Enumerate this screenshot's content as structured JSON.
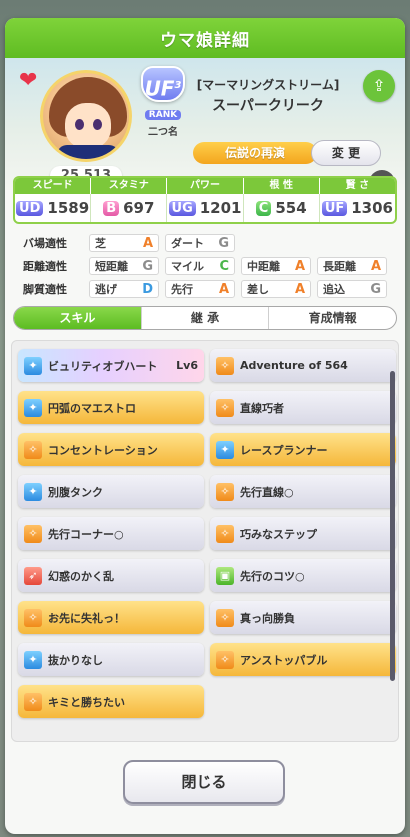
{
  "header": {
    "title": "ウマ娘詳細"
  },
  "profile": {
    "fans": "25,513",
    "rank": "UF",
    "rank_sub": "3",
    "rank_label": "RANK",
    "nickname": "二つ名",
    "epithet": "[マーマリングストリーム]",
    "name": "スーパークリーク",
    "title_tag": "伝説の再演",
    "change_label": "変 更",
    "sub_value": "ー"
  },
  "stats": [
    {
      "label": "スピード",
      "grade": "UD",
      "value": "1589"
    },
    {
      "label": "スタミナ",
      "grade": "B",
      "value": "697"
    },
    {
      "label": "パワー",
      "grade": "UG",
      "value": "1201"
    },
    {
      "label": "根 性",
      "grade": "C",
      "value": "554"
    },
    {
      "label": "賢 さ",
      "grade": "UF",
      "value": "1306"
    }
  ],
  "aptitude": {
    "track_label": "バ場適性",
    "track": [
      {
        "name": "芝",
        "level": "A"
      },
      {
        "name": "ダート",
        "level": "G"
      }
    ],
    "distance_label": "距離適性",
    "distance": [
      {
        "name": "短距離",
        "level": "G"
      },
      {
        "name": "マイル",
        "level": "C"
      },
      {
        "name": "中距離",
        "level": "A"
      },
      {
        "name": "長距離",
        "level": "A"
      }
    ],
    "style_label": "脚質適性",
    "style": [
      {
        "name": "逃げ",
        "level": "D"
      },
      {
        "name": "先行",
        "level": "A"
      },
      {
        "name": "差し",
        "level": "A"
      },
      {
        "name": "追込",
        "level": "G"
      }
    ]
  },
  "tabs": [
    "スキル",
    "継 承",
    "育成情報"
  ],
  "skills": [
    {
      "name": "ビュリティオブハート",
      "lv": "Lv6",
      "style": "rainbow",
      "icon": "blue"
    },
    {
      "name": "Adventure of 564",
      "lv": "",
      "style": "plain",
      "icon": "orange"
    },
    {
      "name": "円弧のマエストロ",
      "lv": "",
      "style": "gold",
      "icon": "blue"
    },
    {
      "name": "直線巧者",
      "lv": "",
      "style": "plain",
      "icon": "orange"
    },
    {
      "name": "コンセントレーション",
      "lv": "",
      "style": "gold",
      "icon": "orange"
    },
    {
      "name": "レースプランナー",
      "lv": "",
      "style": "gold",
      "icon": "blue"
    },
    {
      "name": "別腹タンク",
      "lv": "",
      "style": "plain",
      "icon": "blue"
    },
    {
      "name": "先行直線○",
      "lv": "",
      "style": "plain",
      "icon": "orange"
    },
    {
      "name": "先行コーナー○",
      "lv": "",
      "style": "plain",
      "icon": "orange"
    },
    {
      "name": "巧みなステップ",
      "lv": "",
      "style": "plain",
      "icon": "orange"
    },
    {
      "name": "幻惑のかく乱",
      "lv": "",
      "style": "plain",
      "icon": "red"
    },
    {
      "name": "先行のコツ○",
      "lv": "",
      "style": "plain",
      "icon": "green"
    },
    {
      "name": "お先に失礼っ！",
      "lv": "",
      "style": "gold",
      "icon": "orange"
    },
    {
      "name": "真っ向勝負",
      "lv": "",
      "style": "plain",
      "icon": "orange"
    },
    {
      "name": "抜かりなし",
      "lv": "",
      "style": "plain",
      "icon": "blue"
    },
    {
      "name": "アンストッパブル",
      "lv": "",
      "style": "gold",
      "icon": "orange"
    },
    {
      "name": "キミと勝ちたい",
      "lv": "",
      "style": "gold",
      "icon": "orange"
    }
  ],
  "close_label": "閉じる"
}
